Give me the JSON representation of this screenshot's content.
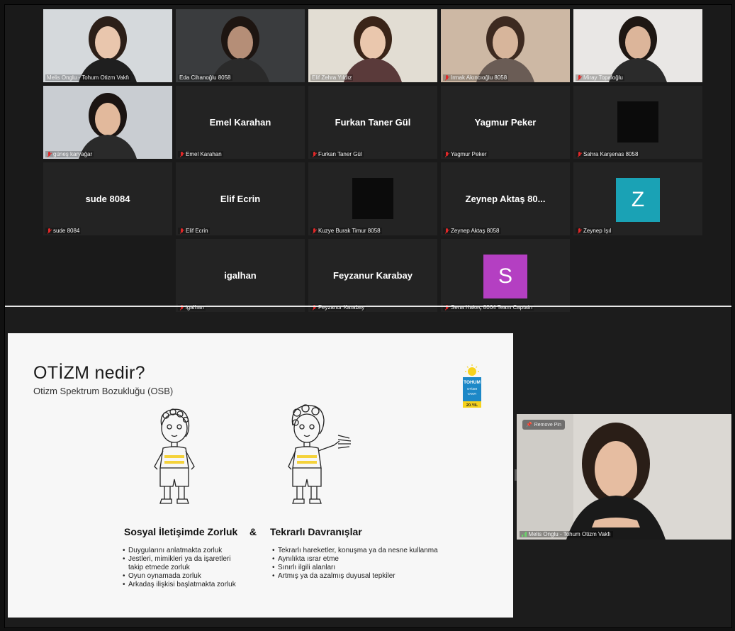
{
  "gallery": {
    "tiles": [
      {
        "label": "Melis Onglu - Tohum Otizm Vakfı",
        "muted": false,
        "video": "melis"
      },
      {
        "label": "Eda Cihanoğlu 8058",
        "muted": false,
        "video": "eda",
        "active": true
      },
      {
        "label": "Elif Zehra Yıldız",
        "muted": false,
        "video": "elif"
      },
      {
        "label": "Irmak Akıncıoğlu 8058",
        "muted": true,
        "video": "irmak"
      },
      {
        "label": "Miray Topaloğlu",
        "muted": true,
        "video": "miray"
      },
      {
        "label": "güneş karyağar",
        "muted": true,
        "video": "gunes"
      },
      {
        "label": "Emel Karahan",
        "muted": true,
        "name": "Emel Karahan"
      },
      {
        "label": "Furkan Taner Gül",
        "muted": true,
        "name": "Furkan Taner Gül"
      },
      {
        "label": "Yagmur Peker",
        "muted": true,
        "name": "Yagmur Peker"
      },
      {
        "label": "Sahra Karşenas 8058",
        "muted": true,
        "square": true
      },
      {
        "label": "sude 8084",
        "muted": true,
        "name": "sude 8084"
      },
      {
        "label": "Elif Ecrin",
        "muted": true,
        "name": "Elif Ecrin"
      },
      {
        "label": "Kuzye Burak Timur 8058",
        "muted": true,
        "square": true
      },
      {
        "label": "Zeynep Aktaş 8058",
        "muted": true,
        "name": "Zeynep Aktaş 80..."
      },
      {
        "label": "Zeynep Işıl",
        "muted": true,
        "letter": "Z",
        "color": "#1aa2b5"
      },
      {
        "label": "igalhan",
        "muted": true,
        "name": "igalhan"
      },
      {
        "label": "Feyzanur Karabay",
        "muted": true,
        "name": "Feyzanur Karabay"
      },
      {
        "label": "Sena Hakeç 8064 Team Captain",
        "muted": true,
        "letter": "S",
        "color": "#b43fc2"
      }
    ]
  },
  "slide": {
    "title": "OTİZM nedir?",
    "subtitle": "Otizm Spektrum Bozukluğu (OSB)",
    "logo": {
      "line1": "TOHUM",
      "line2": "OTİZM",
      "line3": "VAKFI",
      "badge": "20.YIL"
    },
    "left_heading": "Sosyal İletişimde Zorluk",
    "ampersand": "&",
    "right_heading": "Tekrarlı Davranışlar",
    "left_bullets": [
      "Duygularını anlatmakta zorluk",
      "Jestleri, mimikleri ya da işaretleri\ntakip etmede zorluk",
      "Oyun oynamada zorluk",
      "Arkadaş ilişkisi başlatmakta zorluk"
    ],
    "right_bullets": [
      "Tekrarlı hareketler, konuşma ya da nesne kullanma",
      "Aynılıkta ısrar etme",
      "Sınırlı ilgili alanları",
      "Artmış ya da azalmış duyusal tepkiler"
    ]
  },
  "speaker": {
    "pin_label": "Remove Pin",
    "name_label": "Melis Onglu - Tohum Otizm Vakfı"
  },
  "colors": {
    "active_border": "#d6d86a",
    "mute_red": "#e02828",
    "avatar_z": "#1aa2b5",
    "avatar_s": "#b43fc2"
  }
}
